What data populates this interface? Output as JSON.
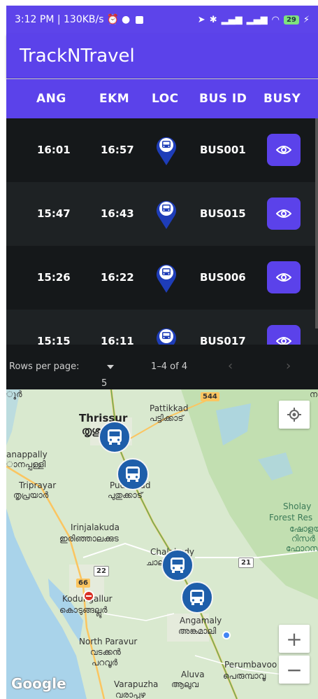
{
  "status_bar": {
    "time_info": "3:12 PM | 130KB/s",
    "battery": "29"
  },
  "app": {
    "title": "TrackNTravel"
  },
  "table": {
    "columns": [
      "ANG",
      "EKM",
      "LOC",
      "BUS ID",
      "BUSY"
    ],
    "rows": [
      {
        "ang": "16:01",
        "ekm": "16:57",
        "bus_id": "BUS001"
      },
      {
        "ang": "15:47",
        "ekm": "16:43",
        "bus_id": "BUS015"
      },
      {
        "ang": "15:26",
        "ekm": "16:22",
        "bus_id": "BUS006"
      },
      {
        "ang": "15:15",
        "ekm": "16:11",
        "bus_id": "BUS017"
      }
    ]
  },
  "pagination": {
    "rows_per_page_label": "Rows per page:",
    "rows_per_page_value": "5",
    "range": "1–4 of 4"
  },
  "map": {
    "labels": {
      "thrissur_en": "Thrissur",
      "thrissur_ml": "തൃശൂർ",
      "pattikkad_en": "Pattikkad",
      "pattikkad_ml": "പട്ടിക്കാട്",
      "anappally_en": "anappally",
      "anappally_ml": "ാനപ്പള്ളി",
      "triprayar_en": "Triprayar",
      "triprayar_ml": "തൃപ്രയാർ",
      "puthukkad_en": "Pudukkad",
      "puthukkad_ml": "പുതുക്കാട്",
      "sholayar_en": "Sholay",
      "sholayar_en2": "Forest Res",
      "sholayar_ml": "ഷോളയ",
      "sholayar_ml2": "റിസർ",
      "sholayar_ml3": "ഫോറസ്",
      "irinjalakuda_en": "Irinjalakuda",
      "irinjalakuda_ml": "ഇരിഞ്ഞാലക്കുട",
      "chalakudy_en": "Chalakudy",
      "chalakudy_ml": "ചാല",
      "kodungallur_en": "Kodungallur",
      "kodungallur_ml": "കൊടുങ്ങല്ലൂർ",
      "angamaly_en": "Angamaly",
      "angamaly_ml": "അങ്കമാലി",
      "north_paravur_en": "North Paravur",
      "north_paravur_ml": "വടക്കൻ",
      "north_paravur_ml2": "പറവൂർ",
      "perumbavoor_en": "Perumbavoo",
      "perumbavoor_ml": "പെരുമ്പാവൂ",
      "aluva_en": "Aluva",
      "aluva_ml": "ആലുവ",
      "varapuzha_en": "Varapuzha",
      "varapuzha_ml": "വരാപ്പുഴ",
      "top_left": "ൂർ",
      "top_right": "ന"
    },
    "road_shields": {
      "r544": "544",
      "r22": "22",
      "r66": "66",
      "r21": "21"
    },
    "attribution": "Google",
    "zoom_in": "+",
    "zoom_out": "−"
  },
  "colors": {
    "primary": "#5b42ea",
    "table_bg": "#15181a",
    "pin": "#1e3db8",
    "bus_marker": "#1e5eaa",
    "map_bg": "#d9e9cf"
  }
}
